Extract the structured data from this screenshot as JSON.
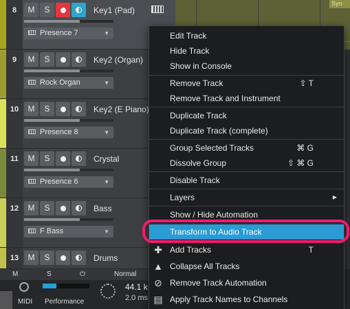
{
  "tracks": [
    {
      "number": "8",
      "name": "Key1 (Pad)",
      "preset": "Presence 7",
      "color": "#a5a51f",
      "selected": true,
      "rec_on": true,
      "mon_on": true
    },
    {
      "number": "9",
      "name": "Key2 (Organ)",
      "preset": "Rock Organ",
      "color": "#9e9e2e",
      "selected": false,
      "rec_on": false,
      "mon_on": false
    },
    {
      "number": "10",
      "name": "Key2 (E Piano)",
      "preset": "Presence 8",
      "color": "#d8e35a",
      "selected": false,
      "rec_on": false,
      "mon_on": false
    },
    {
      "number": "11",
      "name": "Crystal",
      "preset": "Presence 6",
      "color": "#7b8a3a",
      "selected": false,
      "rec_on": false,
      "mon_on": false
    },
    {
      "number": "12",
      "name": "Bass",
      "preset": "F Bass",
      "color": "#c9cf58",
      "selected": false,
      "rec_on": false,
      "mon_on": false
    },
    {
      "number": "13",
      "name": "Drums",
      "preset": "",
      "color": "#c0c04a",
      "selected": false,
      "rec_on": false,
      "mon_on": false
    }
  ],
  "track_buttons": {
    "mute": "M",
    "solo": "S"
  },
  "arrange": {
    "clip_label": "Syn"
  },
  "bottom": {
    "tab_m": "M",
    "tab_s": "S",
    "tab_mode": "Normal",
    "midi": "MIDI",
    "performance": "Performance",
    "sample_rate": "44.1 k",
    "latency": "2.0 ms"
  },
  "context_menu": {
    "items": [
      {
        "label": "Edit Track",
        "shortcut": ""
      },
      {
        "label": "Hide Track",
        "shortcut": ""
      },
      {
        "label": "Show in Console",
        "shortcut": ""
      },
      {
        "label": "Remove Track",
        "shortcut": "⇧ T"
      },
      {
        "label": "Remove Track and Instrument",
        "shortcut": ""
      },
      {
        "label": "Duplicate Track",
        "shortcut": ""
      },
      {
        "label": "Duplicate Track (complete)",
        "shortcut": ""
      },
      {
        "label": "Group Selected Tracks",
        "shortcut": "⌘ G"
      },
      {
        "label": "Dissolve Group",
        "shortcut": "⇧ ⌘ G"
      },
      {
        "label": "Disable Track",
        "shortcut": ""
      },
      {
        "label": "Layers",
        "shortcut": ""
      },
      {
        "label": "Show / Hide Automation",
        "shortcut": ""
      },
      {
        "label": "Transform to Audio Track",
        "shortcut": ""
      },
      {
        "label": "Add Tracks",
        "shortcut": "T"
      },
      {
        "label": "Collapse All Tracks",
        "shortcut": ""
      },
      {
        "label": "Remove Track Automation",
        "shortcut": ""
      },
      {
        "label": "Apply Track Names to Channels",
        "shortcut": ""
      }
    ]
  },
  "colors": {
    "highlight": "#2a9bd3",
    "callout": "#ee1c6e",
    "record": "#e5363f",
    "monitor": "#2fa6c9"
  }
}
